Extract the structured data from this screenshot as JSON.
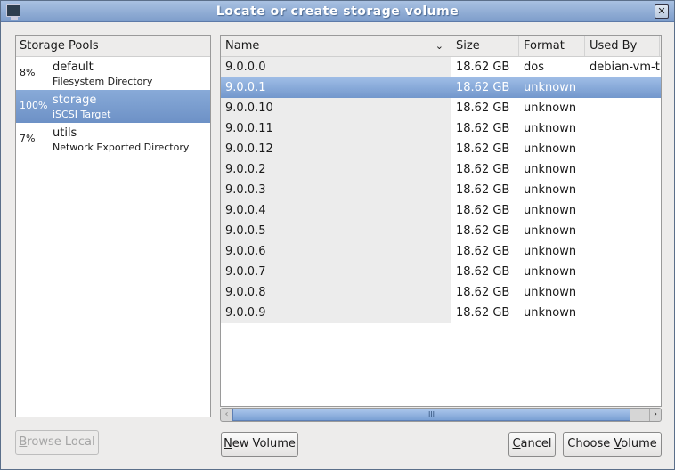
{
  "window": {
    "title": "Locate or create storage volume"
  },
  "pools": {
    "header": "Storage Pools",
    "items": [
      {
        "pct": "8%",
        "name": "default",
        "type": "Filesystem Directory"
      },
      {
        "pct": "100%",
        "name": "storage",
        "type": "iSCSI Target",
        "selected": true
      },
      {
        "pct": "7%",
        "name": "utils",
        "type": "Network Exported Directory"
      }
    ]
  },
  "volumes": {
    "columns": [
      "Name",
      "Size",
      "Format",
      "Used By"
    ],
    "rows": [
      [
        "9.0.0.0",
        "18.62 GB",
        "dos",
        "debian-vm-te"
      ],
      [
        "9.0.0.1",
        "18.62 GB",
        "unknown",
        ""
      ],
      [
        "9.0.0.10",
        "18.62 GB",
        "unknown",
        ""
      ],
      [
        "9.0.0.11",
        "18.62 GB",
        "unknown",
        ""
      ],
      [
        "9.0.0.12",
        "18.62 GB",
        "unknown",
        ""
      ],
      [
        "9.0.0.2",
        "18.62 GB",
        "unknown",
        ""
      ],
      [
        "9.0.0.3",
        "18.62 GB",
        "unknown",
        ""
      ],
      [
        "9.0.0.4",
        "18.62 GB",
        "unknown",
        ""
      ],
      [
        "9.0.0.5",
        "18.62 GB",
        "unknown",
        ""
      ],
      [
        "9.0.0.6",
        "18.62 GB",
        "unknown",
        ""
      ],
      [
        "9.0.0.7",
        "18.62 GB",
        "unknown",
        ""
      ],
      [
        "9.0.0.8",
        "18.62 GB",
        "unknown",
        ""
      ],
      [
        "9.0.0.9",
        "18.62 GB",
        "unknown",
        ""
      ]
    ],
    "selected_index": 1
  },
  "buttons": {
    "browse_local": {
      "mn": "B",
      "rest": "rowse Local"
    },
    "new_volume": {
      "mn": "N",
      "rest": "ew Volume"
    },
    "cancel": {
      "mn": "C",
      "rest": "ancel"
    },
    "choose_volume": {
      "pre": "Choose ",
      "mn": "V",
      "rest": "olume"
    }
  }
}
